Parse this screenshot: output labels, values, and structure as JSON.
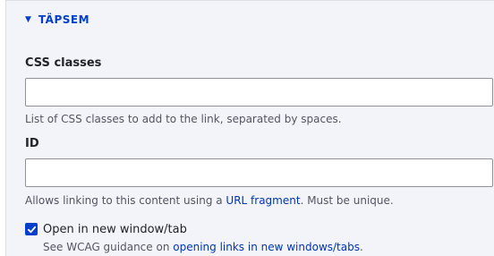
{
  "details": {
    "summary_label": "TÄPSEM"
  },
  "css_classes": {
    "label": "CSS classes",
    "value": "",
    "description": "List of CSS classes to add to the link, separated by spaces."
  },
  "id_field": {
    "label": "ID",
    "value": "",
    "description_before": "Allows linking to this content using a ",
    "description_link": "URL fragment",
    "description_after": ". Must be unique."
  },
  "new_window": {
    "label": "Open in new window/tab",
    "checked": true,
    "guidance_before": "See WCAG guidance on ",
    "guidance_link": "opening links in new windows/tabs",
    "guidance_after": "."
  },
  "icons": {
    "expand": "triangle-down-icon",
    "checkmark": "checkmark-icon"
  },
  "colors": {
    "accent": "#003ecc",
    "link": "#0036b1",
    "panel_bg": "#f3f4f9",
    "text": "#232429",
    "muted": "#545560"
  }
}
